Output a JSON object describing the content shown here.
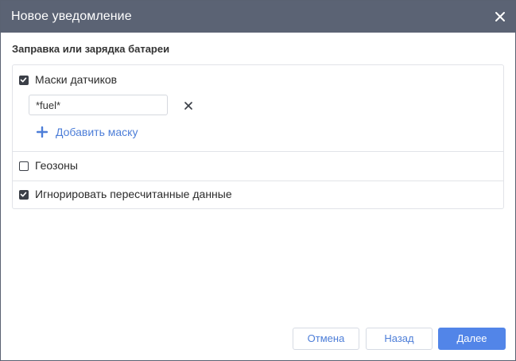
{
  "dialog": {
    "title": "Новое уведомление",
    "close_icon": "close-icon"
  },
  "section": {
    "title": "Заправка или зарядка батареи"
  },
  "options": {
    "sensor_masks": {
      "label": "Маски датчиков",
      "checked": true,
      "mask_value": "*fuel*",
      "remove_icon": "close-icon",
      "add_label": "Добавить маску",
      "add_icon": "plus-icon"
    },
    "geofences": {
      "label": "Геозоны",
      "checked": false
    },
    "ignore_recalculated": {
      "label": "Игнорировать пересчитанные данные",
      "checked": true
    }
  },
  "buttons": {
    "cancel": "Отмена",
    "back": "Назад",
    "next": "Далее"
  },
  "colors": {
    "titlebar": "#5b6374",
    "accent": "#5285e8",
    "link": "#4d7ed8",
    "checkbox": "#3b3f47"
  }
}
